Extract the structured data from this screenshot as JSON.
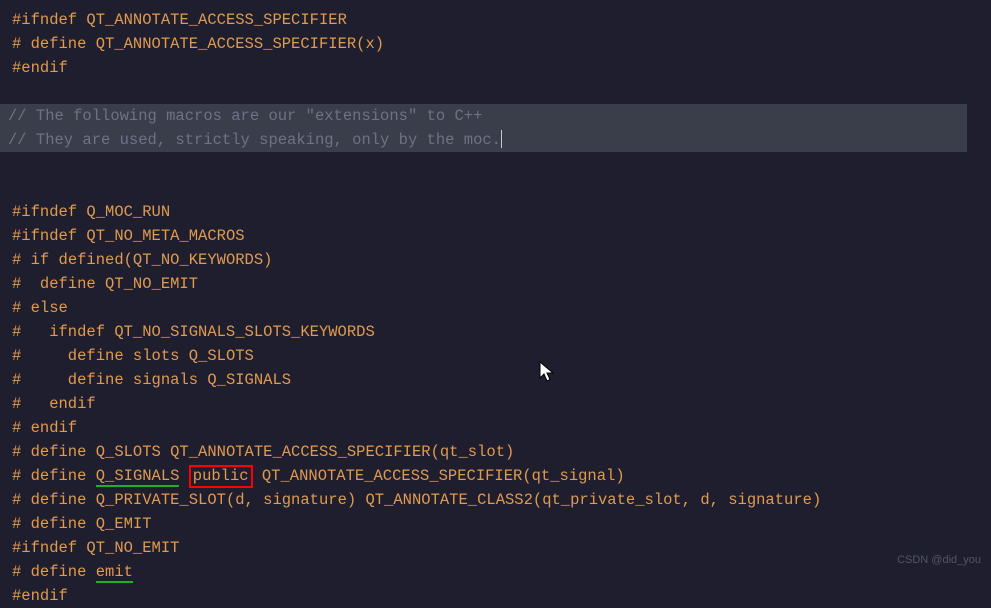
{
  "lines": {
    "l1a": "#ifndef",
    "l1b": " QT_ANNOTATE_ACCESS_SPECIFIER",
    "l2a": "# define",
    "l2b": " QT_ANNOTATE_ACCESS_SPECIFIER(x)",
    "l3a": "#endif",
    "l5": "// The following macros are our \"extensions\" to C++",
    "l6": "// They are used, strictly speaking, only by the moc.",
    "l8a": "#ifndef",
    "l8b": " Q_MOC_RUN",
    "l9a": "#ifndef",
    "l9b": " QT_NO_META_MACROS",
    "l10a": "# if",
    "l10b": " defined(QT_NO_KEYWORDS)",
    "l11a": "#  define",
    "l11b": " QT_NO_EMIT",
    "l12a": "# else",
    "l13a": "#   ifndef",
    "l13b": " QT_NO_SIGNALS_SLOTS_KEYWORDS",
    "l14a": "#     define",
    "l14b": " slots Q_SLOTS",
    "l15a": "#     define",
    "l15b": " signals Q_SIGNALS",
    "l16a": "#   endif",
    "l17a": "# endif",
    "l18a": "# define",
    "l18b": " Q_SLOTS QT_ANNOTATE_ACCESS_SPECIFIER(qt_slot)",
    "l19a": "# define",
    "l19_pre": " ",
    "l19_sig": "Q_SIGNALS",
    "l19_sp": " ",
    "l19_pub": "public",
    "l19_post": " QT_ANNOTATE_ACCESS_SPECIFIER(qt_signal)",
    "l20a": "# define",
    "l20b": " Q_PRIVATE_SLOT(d, signature) QT_ANNOTATE_CLASS2(qt_private_slot, d, signature)",
    "l21a": "# define",
    "l21b": " Q_EMIT",
    "l22a": "#ifndef",
    "l22b": " QT_NO_EMIT",
    "l23a": "# define",
    "l23_sp": " ",
    "l23_emit": "emit",
    "l24a": "#endif"
  },
  "watermark": "CSDN @did_you"
}
